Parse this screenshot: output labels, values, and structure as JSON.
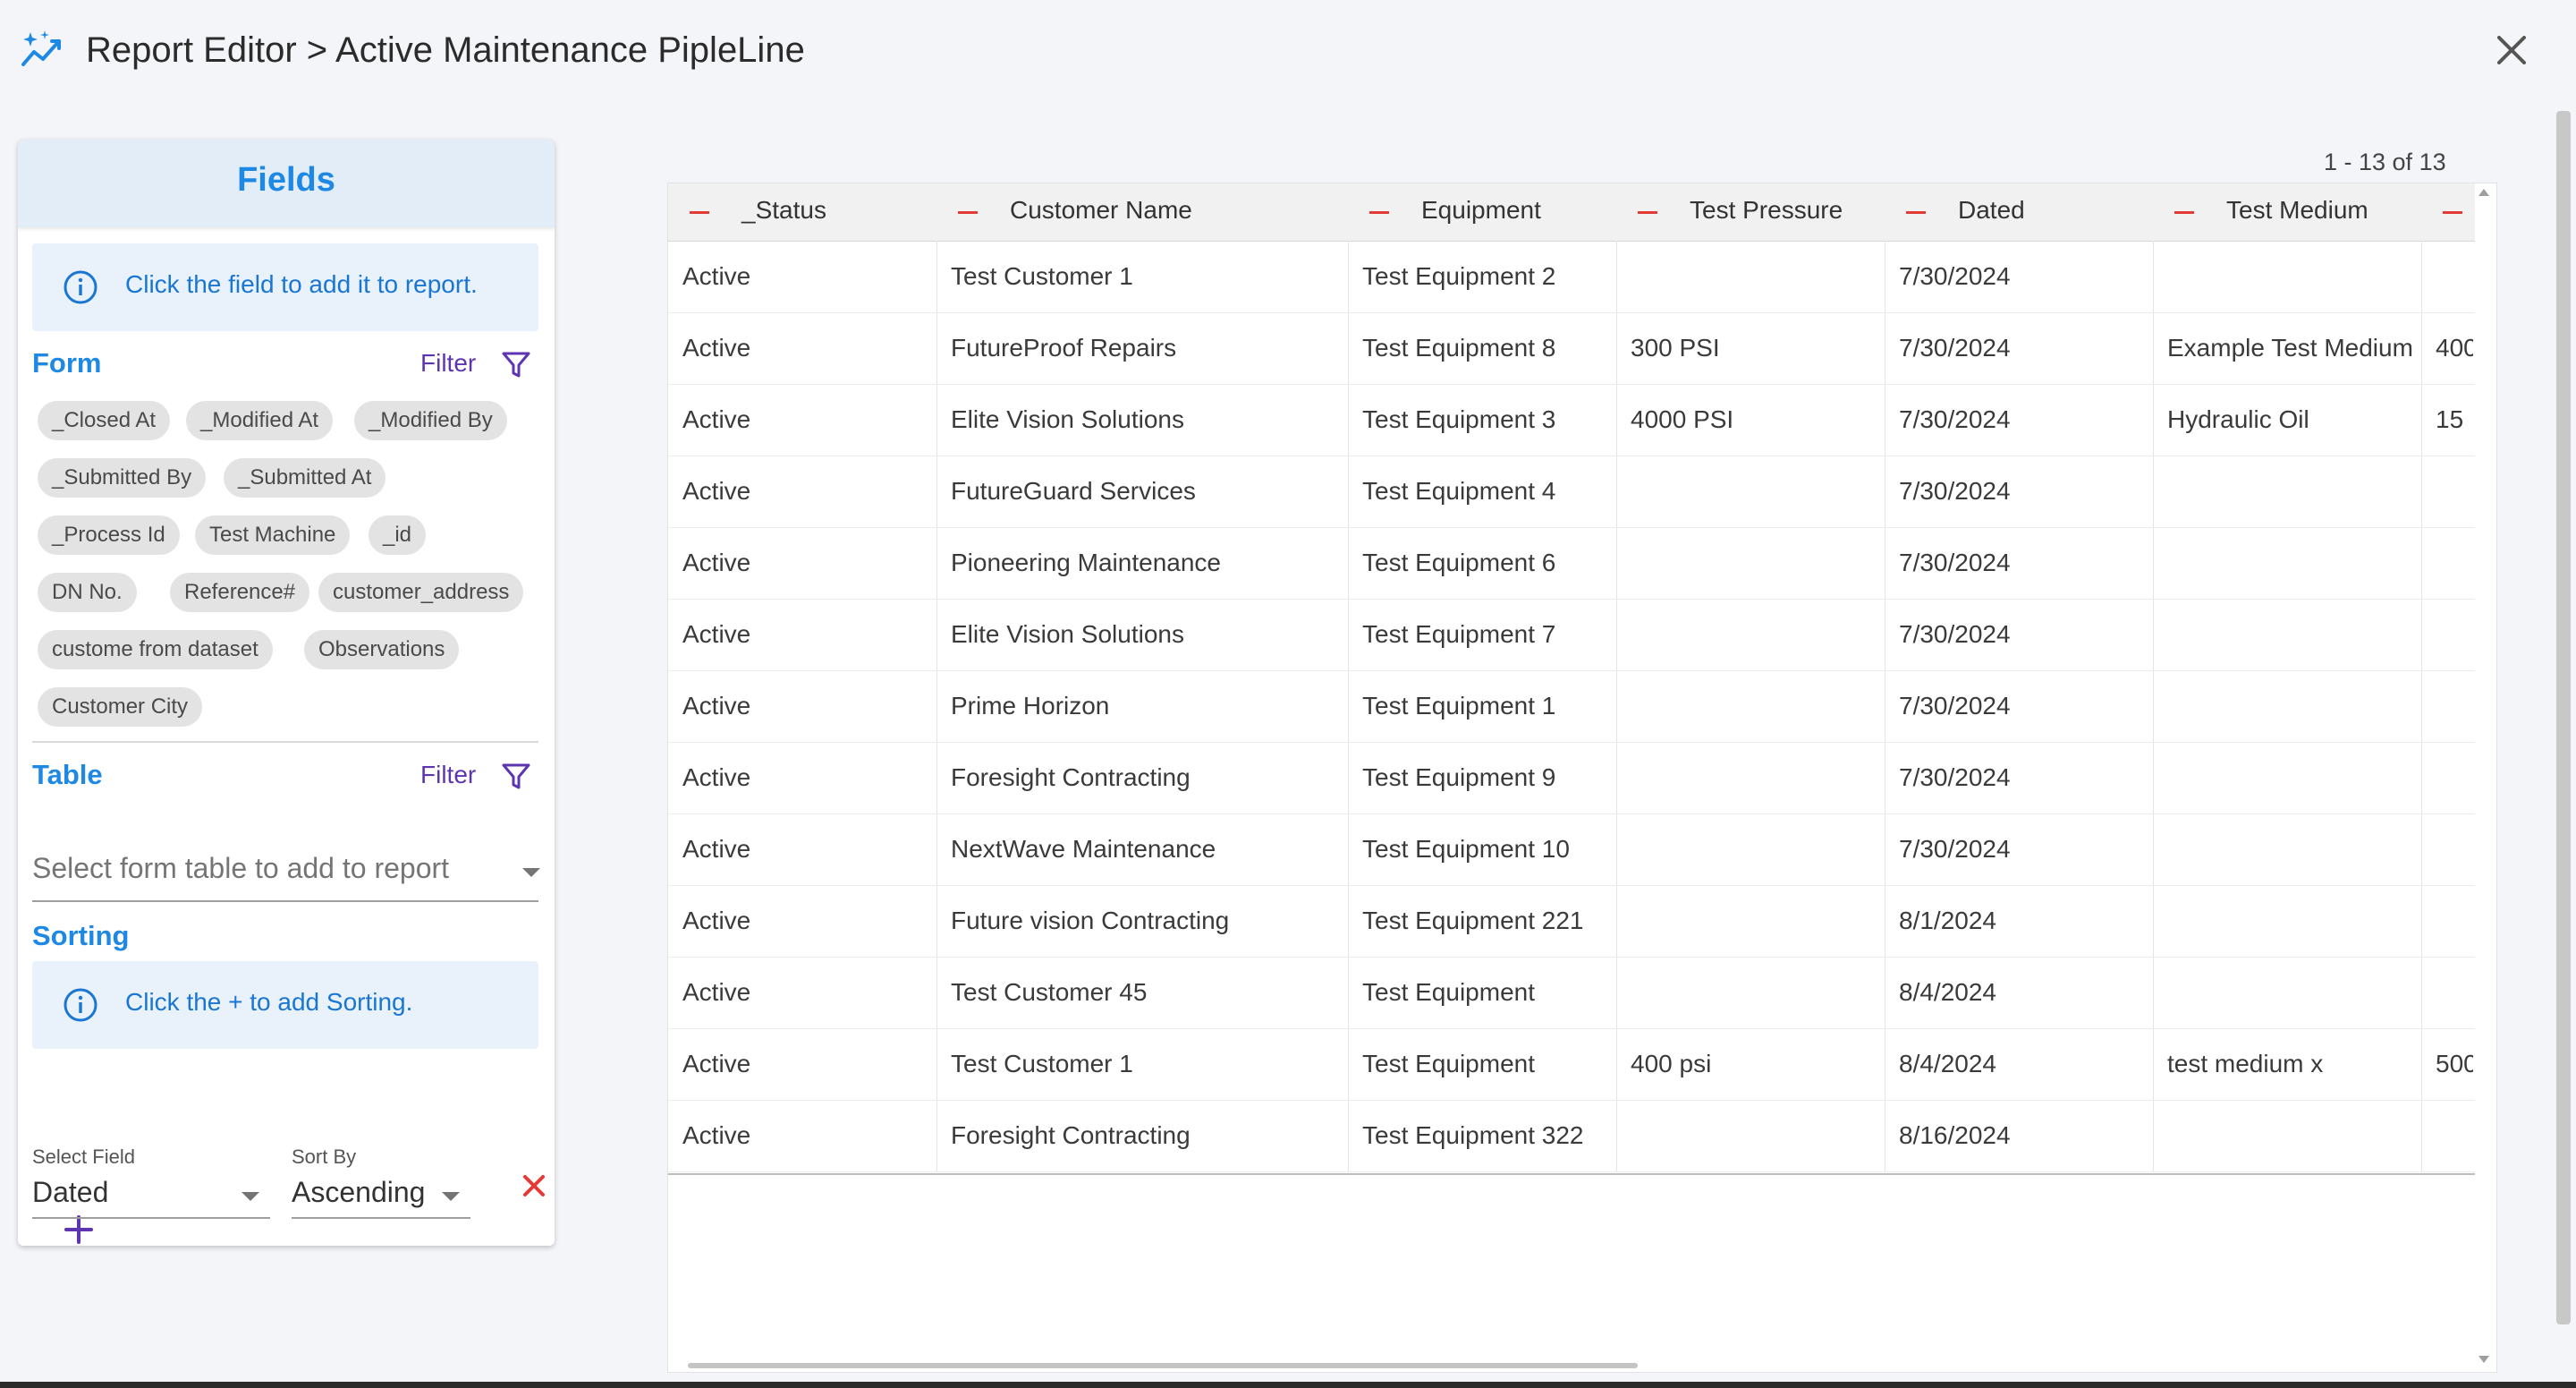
{
  "header": {
    "title": "Report Editor > Active Maintenance PipleLine",
    "logo_icon": "sparkle-chart-icon",
    "close_icon": "close-icon"
  },
  "fields_panel": {
    "title": "Fields",
    "info_text": "Click the field to add it to report.",
    "form_section": {
      "title": "Form",
      "filter_label": "Filter",
      "chips": [
        "_Closed At",
        "_Modified At",
        "_Modified By",
        "_Submitted By",
        "_Submitted At",
        "_Process Id",
        "Test Machine",
        "_id",
        "DN No.",
        "Reference#",
        "customer_address",
        "custome from dataset",
        "Observations",
        "Customer City"
      ]
    },
    "table_section": {
      "title": "Table",
      "filter_label": "Filter",
      "select_placeholder": "Select form table to add to report"
    },
    "sorting_section": {
      "title": "Sorting",
      "info_text": "Click the + to add Sorting.",
      "select_field_label": "Select Field",
      "select_field_value": "Dated",
      "sort_by_label": "Sort By",
      "sort_by_value": "Ascending"
    }
  },
  "pagination": "1 - 13 of 13",
  "table": {
    "columns": [
      "_Status",
      "Customer Name",
      "Equipment",
      "Test Pressure",
      "Dated",
      "Test Medium",
      ""
    ],
    "rows": [
      [
        "Active",
        "Test Customer 1",
        "Test Equipment 2",
        "",
        "7/30/2024",
        "",
        ""
      ],
      [
        "Active",
        "FutureProof Repairs",
        "Test Equipment 8",
        "300 PSI",
        "7/30/2024",
        "Example Test Medium",
        "400"
      ],
      [
        "Active",
        "Elite Vision Solutions",
        "Test Equipment 3",
        "4000 PSI",
        "7/30/2024",
        "Hydraulic Oil",
        "15"
      ],
      [
        "Active",
        "FutureGuard Services",
        "Test Equipment 4",
        "",
        "7/30/2024",
        "",
        ""
      ],
      [
        "Active",
        "Pioneering Maintenance",
        "Test Equipment 6",
        "",
        "7/30/2024",
        "",
        ""
      ],
      [
        "Active",
        "Elite Vision Solutions",
        "Test Equipment 7",
        "",
        "7/30/2024",
        "",
        ""
      ],
      [
        "Active",
        "Prime Horizon",
        "Test Equipment 1",
        "",
        "7/30/2024",
        "",
        ""
      ],
      [
        "Active",
        "Foresight Contracting",
        "Test Equipment 9",
        "",
        "7/30/2024",
        "",
        ""
      ],
      [
        "Active",
        "NextWave Maintenance",
        "Test Equipment 10",
        "",
        "7/30/2024",
        "",
        ""
      ],
      [
        "Active",
        "Future vision Contracting",
        "Test Equipment 221",
        "",
        "8/1/2024",
        "",
        ""
      ],
      [
        "Active",
        "Test Customer 45",
        "Test Equipment",
        "",
        "8/4/2024",
        "",
        ""
      ],
      [
        "Active",
        "Test Customer 1",
        "Test Equipment",
        "400 psi",
        "8/4/2024",
        "test medium x",
        "500"
      ],
      [
        "Active",
        "Foresight Contracting",
        "Test Equipment 322",
        "",
        "8/16/2024",
        "",
        ""
      ]
    ]
  },
  "colors": {
    "accent": "#1e88e5",
    "filter": "#5e35b1",
    "danger": "#e53935",
    "info_bg": "#e9f2fb"
  }
}
